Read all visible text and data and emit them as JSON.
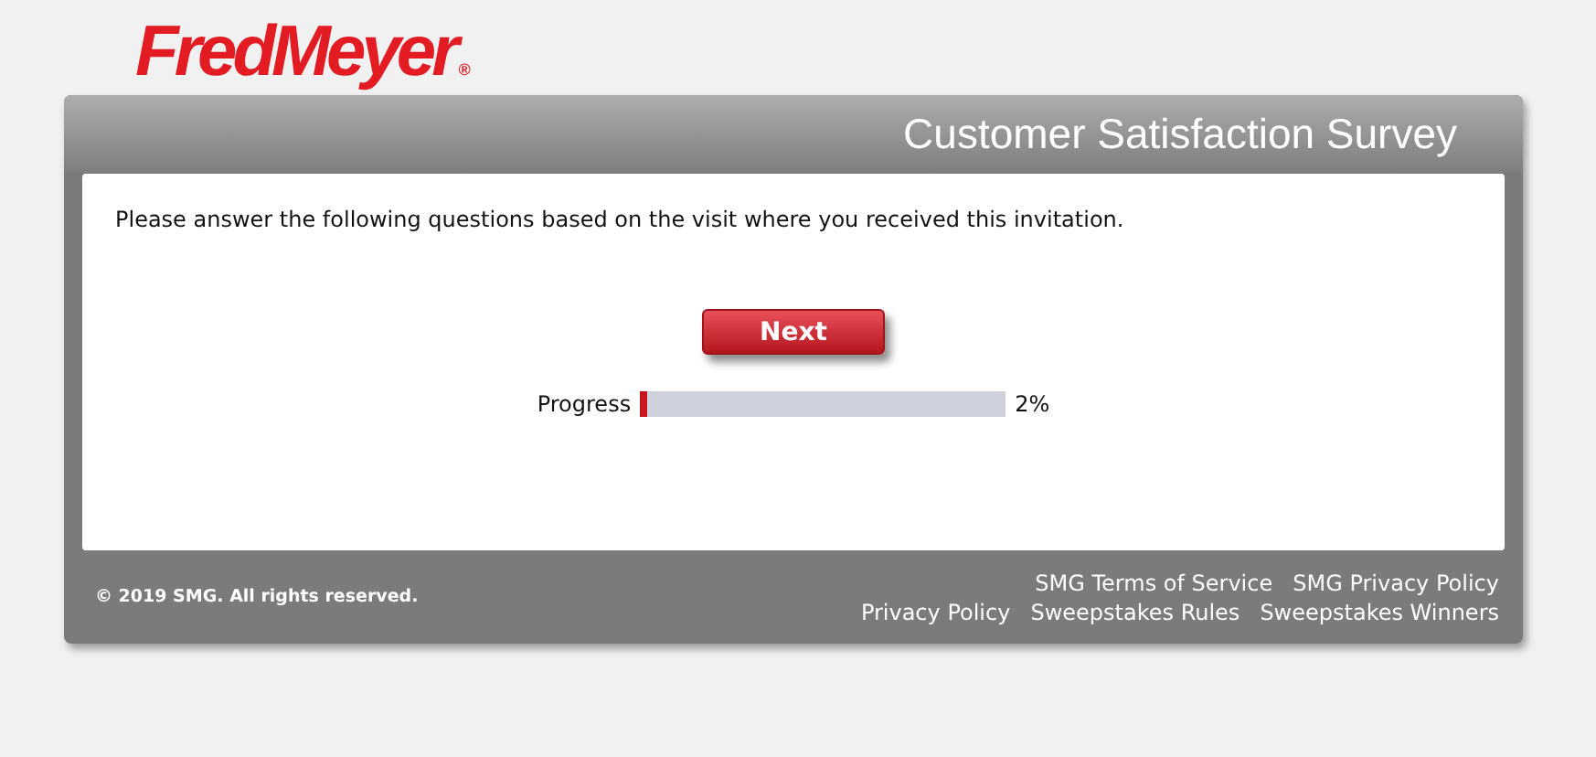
{
  "logo": {
    "text": "FredMeyer",
    "mark": "®"
  },
  "header": {
    "title": "Customer Satisfaction Survey"
  },
  "instructions": "Please answer the following questions based on the visit where you received this invitation.",
  "next_button": "Next",
  "progress": {
    "label": "Progress",
    "level": 0.02,
    "reading": "2%"
  },
  "footer": {
    "copyright": "© 2019 SMG. All rights reserved.",
    "link_rows": [
      [
        "SMG Terms of Service",
        "SMG Privacy Policy"
      ],
      [
        "Privacy Policy",
        "Sweepstakes Rules",
        "Sweepstakes Winners"
      ]
    ]
  }
}
